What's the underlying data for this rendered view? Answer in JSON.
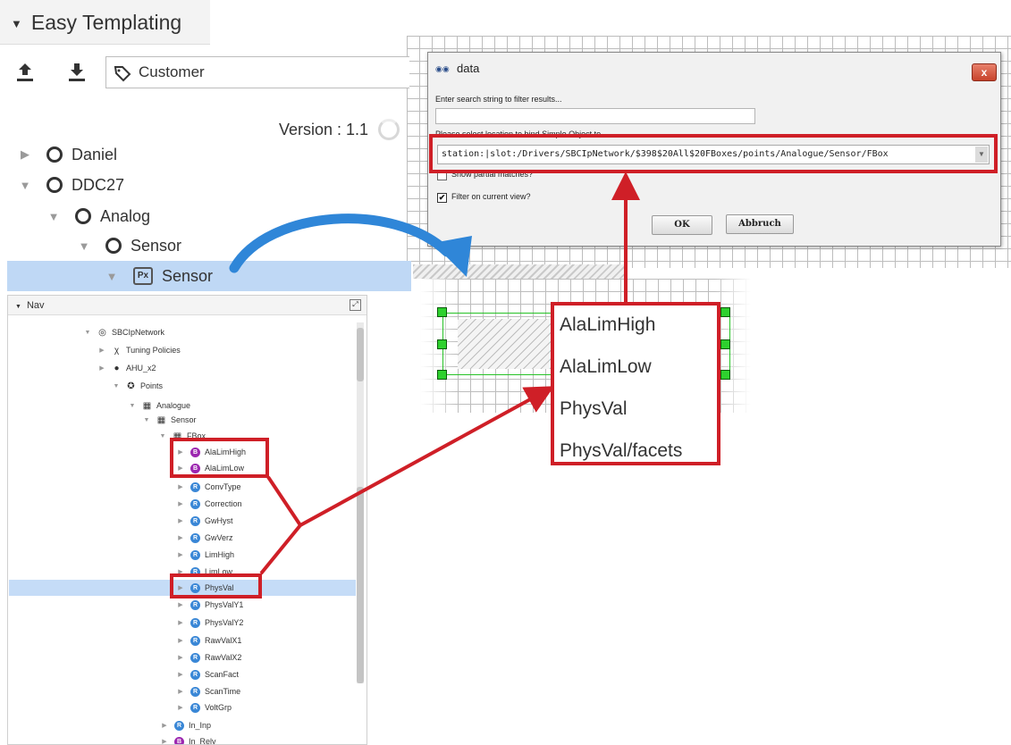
{
  "easy_templating": {
    "title": "Easy Templating",
    "customer": "Customer",
    "version": "Version : 1.1",
    "tree": [
      {
        "label": "Daniel"
      },
      {
        "label": "DDC27"
      },
      {
        "label": "Analog"
      },
      {
        "label": "Sensor"
      },
      {
        "label": "Sensor",
        "icon_text": "Px"
      }
    ]
  },
  "nav": {
    "title": "Nav",
    "rows": [
      {
        "label": "SBCIpNetwork"
      },
      {
        "label": "Tuning Policies"
      },
      {
        "label": "AHU_x2"
      },
      {
        "label": "Points"
      },
      {
        "label": "Analogue"
      },
      {
        "label": "Sensor"
      },
      {
        "label": "FBox"
      },
      {
        "label": "AlaLimHigh",
        "badge": "B"
      },
      {
        "label": "AlaLimLow",
        "badge": "B"
      },
      {
        "label": "ConvType",
        "badge": "R"
      },
      {
        "label": "Correction",
        "badge": "R"
      },
      {
        "label": "GwHyst",
        "badge": "R"
      },
      {
        "label": "GwVerz",
        "badge": "R"
      },
      {
        "label": "LimHigh",
        "badge": "R"
      },
      {
        "label": "LimLow",
        "badge": "R"
      },
      {
        "label": "PhysVal",
        "badge": "R"
      },
      {
        "label": "PhysValY1",
        "badge": "R"
      },
      {
        "label": "PhysValY2",
        "badge": "R"
      },
      {
        "label": "RawValX1",
        "badge": "R"
      },
      {
        "label": "RawValX2",
        "badge": "R"
      },
      {
        "label": "ScanFact",
        "badge": "R"
      },
      {
        "label": "ScanTime",
        "badge": "R"
      },
      {
        "label": "VoltGrp",
        "badge": "R"
      },
      {
        "label": "In_Inp",
        "badge": "R"
      },
      {
        "label": "In_Rely",
        "badge": "B"
      }
    ]
  },
  "dialog": {
    "title": "data",
    "close_label": "x",
    "search_label": "Enter search string to filter results...",
    "search_value": "",
    "location_label": "Please select location to bind Simple Object to",
    "slot_value": "station:|slot:/Drivers/SBCIpNetwork/$398$20All$20FBoxes/points/Analogue/Sensor/FBox",
    "show_partial_label": "Show partial matches?",
    "filter_label": "Filter on current view?",
    "filter_checked_mark": "✔",
    "ok_label": "OK",
    "cancel_label": "Abbruch"
  },
  "popup": {
    "items": [
      "AlaLimHigh",
      "AlaLimLow",
      "PhysVal",
      "PhysVal/facets"
    ]
  },
  "colors": {
    "callout_red": "#cf1f27",
    "arrow_blue": "#2f86d8",
    "selection_blue": "#bfd8f5",
    "handle_green": "#2ed12e"
  }
}
